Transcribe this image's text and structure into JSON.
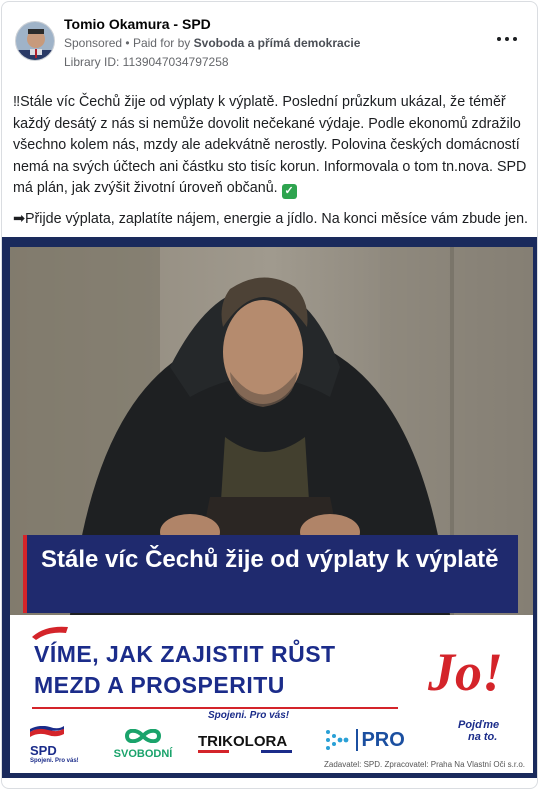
{
  "post": {
    "page_name": "Tomio Okamura - SPD",
    "sponsored_label": "Sponsored",
    "paid_for_prefix": "Paid for by",
    "paid_for_by": "Svoboda a přímá demokracie",
    "library_id": "Library ID: 1139047034797258",
    "text_paragraph_1": "‼Stále víc Čechů žije od výplaty k výplatě. Poslední průzkum ukázal, že téměř každý desátý z nás si nemůže dovolit nečekané výdaje. Podle ekonomů zdražilo všechno kolem nás, mzdy ale adekvátně nerostly. Polovina českých domácností nemá na svých účtech ani částku sto tisíc korun. Informovala o tom tn.nova. SPD má plán, jak zvýšit životní úroveň občanů.",
    "text_paragraph_2": "➡Přijde výplata, zaplatíte nájem, energie a jídlo. Na konci měsíce vám zbude jen..."
  },
  "creative": {
    "headline": "Stále víc Čechů žije od výplaty k výplatě",
    "slogan_line_1": "VÍME, JAK ZAJISTIT RŮST",
    "slogan_line_2": "MEZD A PROSPERITU",
    "spojeni": "Spojeni. Pro vás!",
    "jo": "Jo!",
    "jo_sub_1": "Pojďme",
    "jo_sub_2": "na to.",
    "logo_spd": "SPD",
    "logo_spd_sub": "Spojeni. Pro vás!",
    "logo_svobodni": "SVOBODNÍ",
    "logo_trikolora": "TRIKOLORA",
    "logo_pro": "PRO",
    "footer": "Zadavatel: SPD. Zpracovatel: Praha Na Vlastní Oči s.r.o."
  },
  "colors": {
    "navy": "#1f2a6e",
    "red": "#d4242a",
    "brand_blue": "#1b2c8a"
  }
}
